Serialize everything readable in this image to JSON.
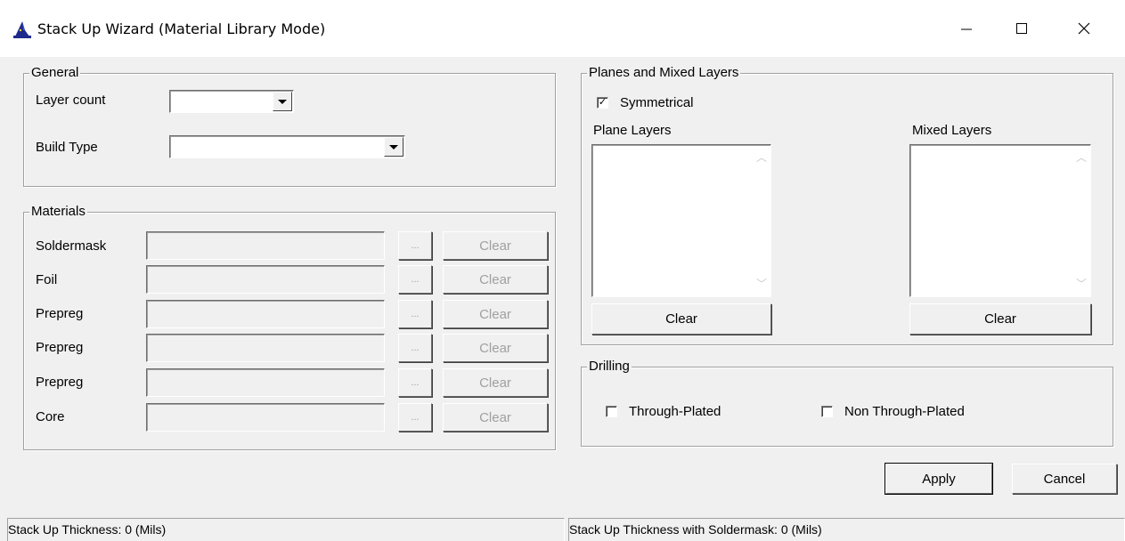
{
  "window": {
    "title": "Stack Up Wizard (Material Library Mode)",
    "icon": "wizard-hat-icon",
    "controls": [
      "minimize-icon",
      "maximize-icon",
      "close-icon"
    ]
  },
  "general": {
    "legend": "General",
    "layer_count_label": "Layer count",
    "layer_count_value": "",
    "build_type_label": "Build Type",
    "build_type_value": ""
  },
  "materials": {
    "legend": "Materials",
    "browse_label": "...",
    "clear_label": "Clear",
    "rows": [
      {
        "label": "Soldermask",
        "value": ""
      },
      {
        "label": "Foil",
        "value": ""
      },
      {
        "label": "Prepreg",
        "value": ""
      },
      {
        "label": "Prepreg",
        "value": ""
      },
      {
        "label": "Prepreg",
        "value": ""
      },
      {
        "label": "Core",
        "value": ""
      }
    ]
  },
  "planes": {
    "legend": "Planes and Mixed Layers",
    "symmetrical_label": "Symmetrical",
    "symmetrical_checked": true,
    "plane_layers_label": "Plane Layers",
    "mixed_layers_label": "Mixed Layers",
    "clear_label": "Clear"
  },
  "drilling": {
    "legend": "Drilling",
    "through_plated_label": "Through-Plated",
    "through_plated_checked": false,
    "non_through_plated_label": "Non Through-Plated",
    "non_through_plated_checked": false
  },
  "actions": {
    "apply_label": "Apply",
    "cancel_label": "Cancel"
  },
  "status": {
    "thickness": "Stack Up Thickness: 0 (Mils)",
    "thickness_with_soldermask": "Stack Up Thickness with Soldermask: 0 (Mils)"
  }
}
